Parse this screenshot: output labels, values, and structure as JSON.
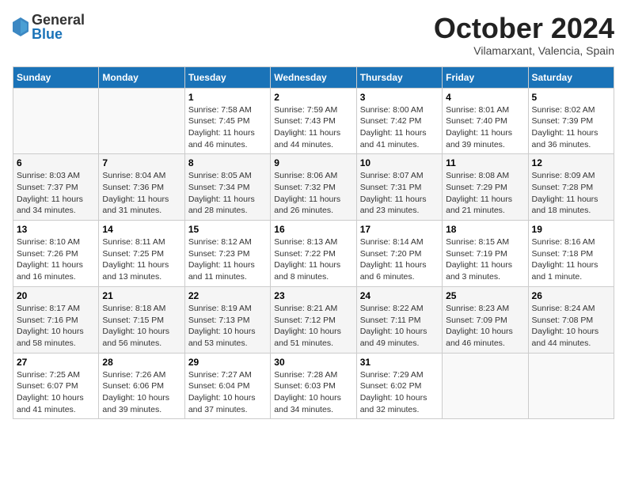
{
  "logo": {
    "general": "General",
    "blue": "Blue"
  },
  "title": "October 2024",
  "location": "Vilamarxant, Valencia, Spain",
  "days_of_week": [
    "Sunday",
    "Monday",
    "Tuesday",
    "Wednesday",
    "Thursday",
    "Friday",
    "Saturday"
  ],
  "weeks": [
    [
      {
        "day": "",
        "info": ""
      },
      {
        "day": "",
        "info": ""
      },
      {
        "day": "1",
        "info": "Sunrise: 7:58 AM\nSunset: 7:45 PM\nDaylight: 11 hours and 46 minutes."
      },
      {
        "day": "2",
        "info": "Sunrise: 7:59 AM\nSunset: 7:43 PM\nDaylight: 11 hours and 44 minutes."
      },
      {
        "day": "3",
        "info": "Sunrise: 8:00 AM\nSunset: 7:42 PM\nDaylight: 11 hours and 41 minutes."
      },
      {
        "day": "4",
        "info": "Sunrise: 8:01 AM\nSunset: 7:40 PM\nDaylight: 11 hours and 39 minutes."
      },
      {
        "day": "5",
        "info": "Sunrise: 8:02 AM\nSunset: 7:39 PM\nDaylight: 11 hours and 36 minutes."
      }
    ],
    [
      {
        "day": "6",
        "info": "Sunrise: 8:03 AM\nSunset: 7:37 PM\nDaylight: 11 hours and 34 minutes."
      },
      {
        "day": "7",
        "info": "Sunrise: 8:04 AM\nSunset: 7:36 PM\nDaylight: 11 hours and 31 minutes."
      },
      {
        "day": "8",
        "info": "Sunrise: 8:05 AM\nSunset: 7:34 PM\nDaylight: 11 hours and 28 minutes."
      },
      {
        "day": "9",
        "info": "Sunrise: 8:06 AM\nSunset: 7:32 PM\nDaylight: 11 hours and 26 minutes."
      },
      {
        "day": "10",
        "info": "Sunrise: 8:07 AM\nSunset: 7:31 PM\nDaylight: 11 hours and 23 minutes."
      },
      {
        "day": "11",
        "info": "Sunrise: 8:08 AM\nSunset: 7:29 PM\nDaylight: 11 hours and 21 minutes."
      },
      {
        "day": "12",
        "info": "Sunrise: 8:09 AM\nSunset: 7:28 PM\nDaylight: 11 hours and 18 minutes."
      }
    ],
    [
      {
        "day": "13",
        "info": "Sunrise: 8:10 AM\nSunset: 7:26 PM\nDaylight: 11 hours and 16 minutes."
      },
      {
        "day": "14",
        "info": "Sunrise: 8:11 AM\nSunset: 7:25 PM\nDaylight: 11 hours and 13 minutes."
      },
      {
        "day": "15",
        "info": "Sunrise: 8:12 AM\nSunset: 7:23 PM\nDaylight: 11 hours and 11 minutes."
      },
      {
        "day": "16",
        "info": "Sunrise: 8:13 AM\nSunset: 7:22 PM\nDaylight: 11 hours and 8 minutes."
      },
      {
        "day": "17",
        "info": "Sunrise: 8:14 AM\nSunset: 7:20 PM\nDaylight: 11 hours and 6 minutes."
      },
      {
        "day": "18",
        "info": "Sunrise: 8:15 AM\nSunset: 7:19 PM\nDaylight: 11 hours and 3 minutes."
      },
      {
        "day": "19",
        "info": "Sunrise: 8:16 AM\nSunset: 7:18 PM\nDaylight: 11 hours and 1 minute."
      }
    ],
    [
      {
        "day": "20",
        "info": "Sunrise: 8:17 AM\nSunset: 7:16 PM\nDaylight: 10 hours and 58 minutes."
      },
      {
        "day": "21",
        "info": "Sunrise: 8:18 AM\nSunset: 7:15 PM\nDaylight: 10 hours and 56 minutes."
      },
      {
        "day": "22",
        "info": "Sunrise: 8:19 AM\nSunset: 7:13 PM\nDaylight: 10 hours and 53 minutes."
      },
      {
        "day": "23",
        "info": "Sunrise: 8:21 AM\nSunset: 7:12 PM\nDaylight: 10 hours and 51 minutes."
      },
      {
        "day": "24",
        "info": "Sunrise: 8:22 AM\nSunset: 7:11 PM\nDaylight: 10 hours and 49 minutes."
      },
      {
        "day": "25",
        "info": "Sunrise: 8:23 AM\nSunset: 7:09 PM\nDaylight: 10 hours and 46 minutes."
      },
      {
        "day": "26",
        "info": "Sunrise: 8:24 AM\nSunset: 7:08 PM\nDaylight: 10 hours and 44 minutes."
      }
    ],
    [
      {
        "day": "27",
        "info": "Sunrise: 7:25 AM\nSunset: 6:07 PM\nDaylight: 10 hours and 41 minutes."
      },
      {
        "day": "28",
        "info": "Sunrise: 7:26 AM\nSunset: 6:06 PM\nDaylight: 10 hours and 39 minutes."
      },
      {
        "day": "29",
        "info": "Sunrise: 7:27 AM\nSunset: 6:04 PM\nDaylight: 10 hours and 37 minutes."
      },
      {
        "day": "30",
        "info": "Sunrise: 7:28 AM\nSunset: 6:03 PM\nDaylight: 10 hours and 34 minutes."
      },
      {
        "day": "31",
        "info": "Sunrise: 7:29 AM\nSunset: 6:02 PM\nDaylight: 10 hours and 32 minutes."
      },
      {
        "day": "",
        "info": ""
      },
      {
        "day": "",
        "info": ""
      }
    ]
  ]
}
